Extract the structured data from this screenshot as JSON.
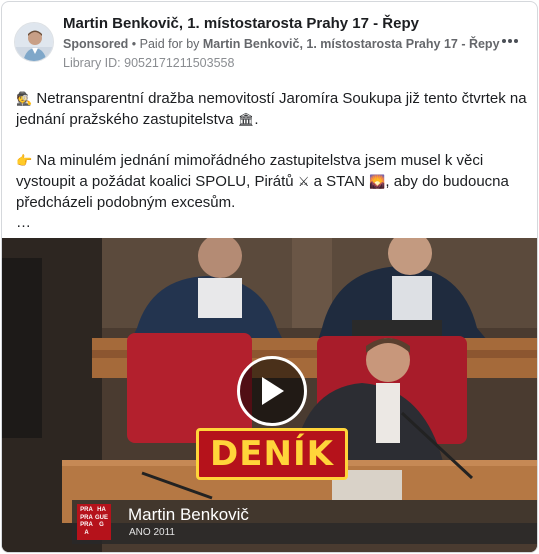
{
  "post": {
    "author": "Martin Benkovič, 1. místostarosta Prahy 17 - Řepy",
    "sponsored_label": "Sponsored",
    "paid_for_prefix": "Paid for by",
    "paid_for_name": "Martin Benkovič, 1. místostarosta Prahy 17 - Řepy",
    "library_id": "Library ID: 9052171211503558",
    "more_icon": "more-horizontal-icon"
  },
  "body": {
    "line1_emoji": "🕵",
    "line1_text": "Netransparentní dražba nemovitostí Jaromíra Soukupa již tento čtvrtek na jednání pražského zastupitelstva",
    "line1_emoji_end": "🏛",
    "line1_end": ".",
    "line2_emoji": "👉",
    "line2_text_a": "Na minulém jednání mimořádného zastupitelstva jsem musel k věci vystoupit a požádat koalici SPOLU, Pirátů",
    "line2_emoji_b": "⚔",
    "line2_text_b": "a STAN",
    "line2_emoji_c": "🌄",
    "line2_text_c": ", aby do budoucna předcházeli podobným excesům.",
    "ellipsis": "…"
  },
  "video": {
    "play_icon": "play-icon",
    "badge_text": "DENÍK",
    "lower_third_name": "Martin Benkovič",
    "lower_third_party": "ANO 2011",
    "logo_letters": [
      "PRA",
      "HA",
      "PRA",
      "GUE",
      "PRA",
      "G",
      "A",
      ""
    ]
  },
  "colors": {
    "badge_bg": "#b5121b",
    "badge_text": "#ffd53a",
    "lower_third_bg": "#282828"
  }
}
